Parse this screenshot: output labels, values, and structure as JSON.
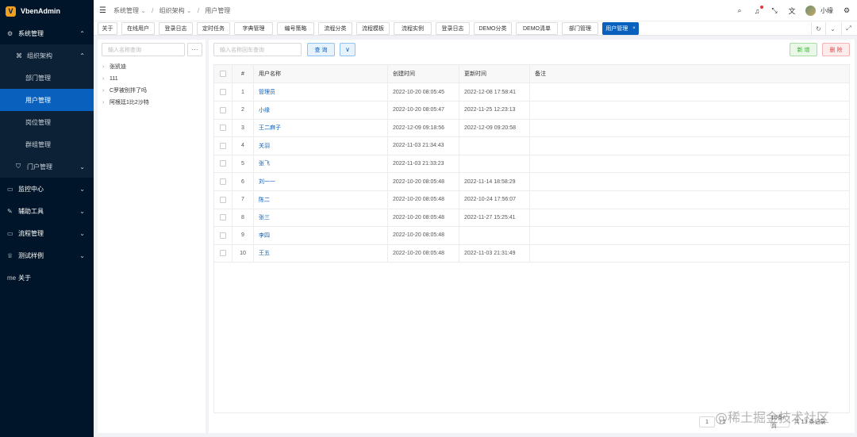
{
  "app": {
    "name": "VbenAdmin",
    "logo_letter": "V"
  },
  "sidebar": {
    "items": [
      {
        "icon": "gear-icon",
        "glyph": "⚙",
        "label": "系统管理",
        "arrow": "⌃",
        "level": "top"
      },
      {
        "icon": "sitemap-icon",
        "glyph": "⌘",
        "label": "组织架构",
        "arrow": "⌃",
        "level": "sub"
      },
      {
        "label": "部门管理",
        "level": "leaf"
      },
      {
        "label": "用户管理",
        "level": "leaf",
        "active": true
      },
      {
        "label": "岗位管理",
        "level": "leaf"
      },
      {
        "label": "群组管理",
        "level": "leaf"
      },
      {
        "icon": "shield-icon",
        "glyph": "⛉",
        "label": "门户管理",
        "arrow": "⌄",
        "level": "sub"
      },
      {
        "icon": "monitor-icon",
        "glyph": "▭",
        "label": "监控中心",
        "arrow": "⌄",
        "level": "top"
      },
      {
        "icon": "tool-icon",
        "glyph": "✎",
        "label": "辅助工具",
        "arrow": "⌄",
        "level": "top"
      },
      {
        "icon": "flow-icon",
        "glyph": "▭",
        "label": "流程管理",
        "arrow": "⌄",
        "level": "top"
      },
      {
        "icon": "trophy-icon",
        "glyph": "♕",
        "label": "测试样例",
        "arrow": "⌄",
        "level": "top"
      },
      {
        "icon": "me-icon",
        "glyph": "me",
        "label": "关于",
        "level": "top"
      }
    ]
  },
  "header": {
    "breadcrumb": [
      "系统管理",
      "组织架构",
      "用户管理"
    ],
    "username": "小缘"
  },
  "tabs": [
    "关于",
    "在线用户",
    "登录日志",
    "定时任务",
    "字典管理",
    "编号策略",
    "流程分类",
    "流程模板",
    "流程实例",
    "登录日志",
    "DEMO分类",
    "DEMO清单",
    "部门管理",
    "用户管理"
  ],
  "tree": {
    "search_placeholder": "输入名称查询",
    "more_label": "···",
    "nodes": [
      "张凯迪",
      "111",
      "C罗被别拌了吗",
      "阿根廷1比2沙特"
    ]
  },
  "toolbar": {
    "search_placeholder": "输入名称回车查询",
    "query_label": "查 询",
    "toggle_label": "∨",
    "add_label": "新 增",
    "delete_label": "删 除"
  },
  "table": {
    "headers": {
      "index": "#",
      "name": "用户名称",
      "created": "创建时间",
      "updated": "更新时间",
      "remark": "备注"
    },
    "rows": [
      {
        "index": "1",
        "name": "管理员",
        "created": "2022-10-20 08:05:45",
        "updated": "2022-12-08 17:58:41"
      },
      {
        "index": "2",
        "name": "小缘",
        "created": "2022-10-20 08:05:47",
        "updated": "2022-11-25 12:23:13"
      },
      {
        "index": "3",
        "name": "王二麻子",
        "created": "2022-12-09 09:18:56",
        "updated": "2022-12-09 09:20:58"
      },
      {
        "index": "4",
        "name": "关羽",
        "created": "2022-11-03 21:34:43",
        "updated": ""
      },
      {
        "index": "5",
        "name": "张飞",
        "created": "2022-11-03 21:33:23",
        "updated": ""
      },
      {
        "index": "6",
        "name": "刘一一",
        "created": "2022-10-20 08:05:48",
        "updated": "2022-11-14 18:58:29"
      },
      {
        "index": "7",
        "name": "陈二",
        "created": "2022-10-20 08:05:48",
        "updated": "2022-10-24 17:56:07"
      },
      {
        "index": "8",
        "name": "张三",
        "created": "2022-10-20 08:05:48",
        "updated": "2022-11-27 15:25:41"
      },
      {
        "index": "9",
        "name": "李四",
        "created": "2022-10-20 08:05:48",
        "updated": ""
      },
      {
        "index": "10",
        "name": "王五",
        "created": "2022-10-20 08:05:48",
        "updated": "2022-11-03 21:31:49"
      }
    ]
  },
  "pager": {
    "current": "1",
    "total_pages": "/ 2",
    "page_size": "10条/页",
    "total": "共 13 条记录"
  },
  "watermark": "@稀土掘金技术社区",
  "colors": {
    "sidebar_bg": "#001529",
    "primary": "#0960bd",
    "success": "#3eaf35",
    "danger": "#e24c4c"
  }
}
